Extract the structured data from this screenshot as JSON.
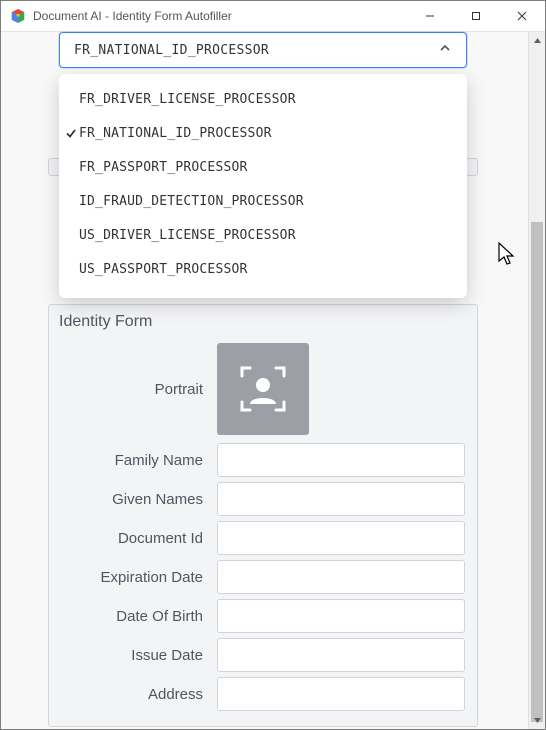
{
  "window": {
    "title": "Document AI - Identity Form Autofiller",
    "min_label": "—",
    "max_label": "▢",
    "close_label": "✕"
  },
  "dropdown": {
    "selected": "FR_NATIONAL_ID_PROCESSOR",
    "options": [
      {
        "label": "FR_DRIVER_LICENSE_PROCESSOR",
        "selected": false
      },
      {
        "label": "FR_NATIONAL_ID_PROCESSOR",
        "selected": true
      },
      {
        "label": "FR_PASSPORT_PROCESSOR",
        "selected": false
      },
      {
        "label": "ID_FRAUD_DETECTION_PROCESSOR",
        "selected": false
      },
      {
        "label": "US_DRIVER_LICENSE_PROCESSOR",
        "selected": false
      },
      {
        "label": "US_PASSPORT_PROCESSOR",
        "selected": false
      }
    ]
  },
  "identity_form": {
    "title": "Identity Form",
    "portrait_label": "Portrait",
    "fields": [
      {
        "label": "Family Name",
        "value": ""
      },
      {
        "label": "Given Names",
        "value": ""
      },
      {
        "label": "Document Id",
        "value": ""
      },
      {
        "label": "Expiration Date",
        "value": ""
      },
      {
        "label": "Date Of Birth",
        "value": ""
      },
      {
        "label": "Issue Date",
        "value": ""
      },
      {
        "label": "Address",
        "value": ""
      }
    ]
  },
  "colors": {
    "accent": "#3b82f6",
    "panel_bg": "#f3f4f6",
    "text_muted": "#505560",
    "portrait_bg": "#9ca0a6"
  }
}
